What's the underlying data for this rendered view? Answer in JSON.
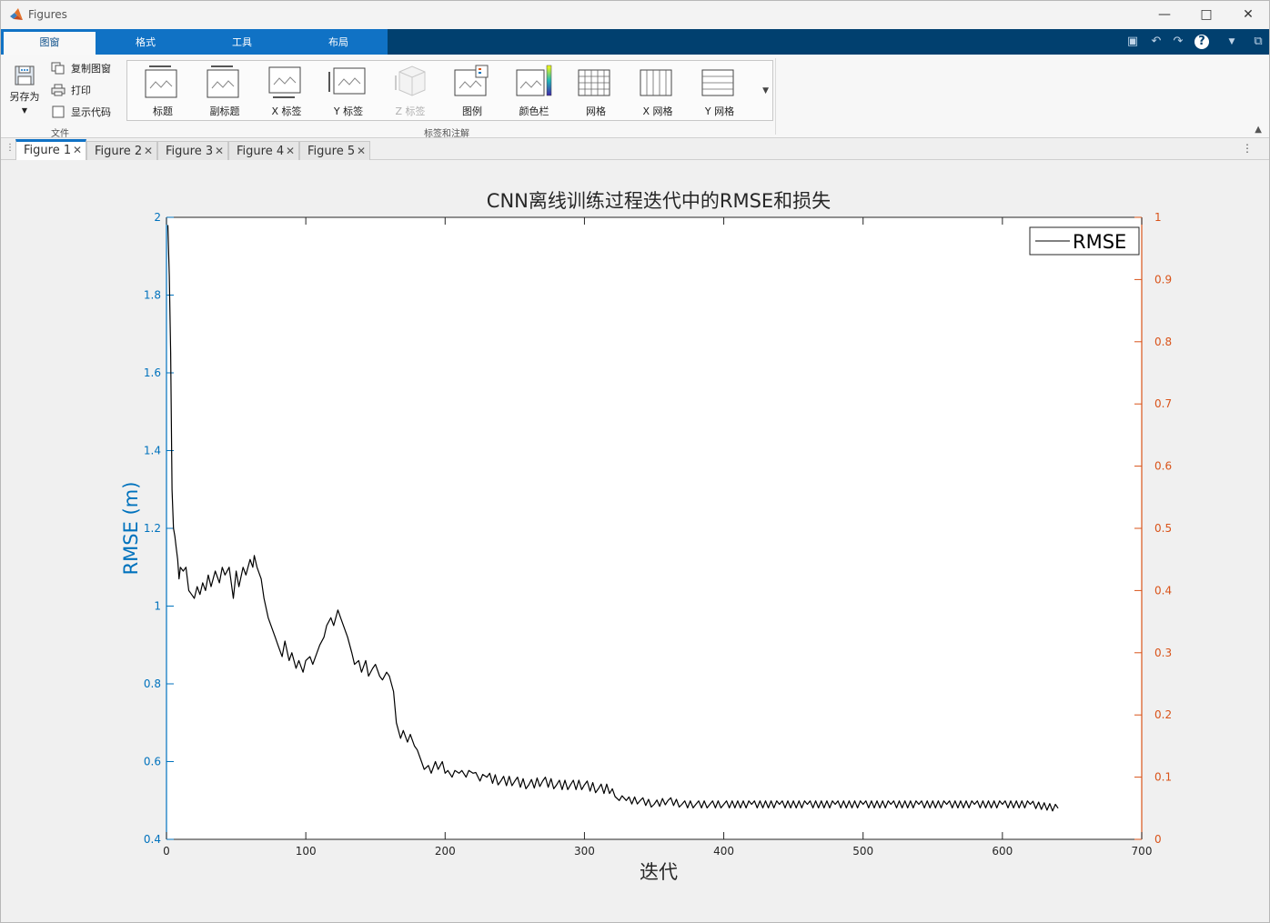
{
  "window": {
    "title": "Figures"
  },
  "ribbon_tabs": [
    "图窗",
    "格式",
    "工具",
    "布局"
  ],
  "file_group": {
    "save_as": "另存为",
    "copy_figure": "复制图窗",
    "print": "打印",
    "show_code": "显示代码",
    "label": "文件"
  },
  "annotation_group": {
    "items": [
      "标题",
      "副标题",
      "X 标签",
      "Y 标签",
      "Z 标签",
      "图例",
      "颜色栏",
      "网格",
      "X 网格",
      "Y 网格"
    ],
    "label": "标签和注解"
  },
  "doc_tabs": [
    "Figure 1",
    "Figure 2",
    "Figure 3",
    "Figure 4",
    "Figure 5"
  ],
  "colors": {
    "left_axis": "#0072bd",
    "right_axis": "#d95319",
    "series": "#000000"
  },
  "chart_data": {
    "type": "line",
    "title": "CNN离线训练过程迭代中的RMSE和损失",
    "xlabel": "迭代",
    "ylabel": "RMSE (m)",
    "xlim": [
      0,
      700
    ],
    "ylim": [
      0.4,
      2
    ],
    "y2lim": [
      0,
      1
    ],
    "xticks": [
      "0",
      "100",
      "200",
      "300",
      "400",
      "500",
      "600",
      "700"
    ],
    "yticks": [
      "0.4",
      "0.6",
      "0.8",
      "1",
      "1.2",
      "1.4",
      "1.6",
      "1.8",
      "2"
    ],
    "y2ticks": [
      "0",
      "0.1",
      "0.2",
      "0.3",
      "0.4",
      "0.5",
      "0.6",
      "0.7",
      "0.8",
      "0.9",
      "1"
    ],
    "legend": {
      "entries": [
        "RMSE"
      ],
      "position": "top-right"
    },
    "grid": false,
    "series": [
      {
        "name": "RMSE",
        "x": [
          1,
          2,
          3,
          4,
          5,
          6,
          7,
          8,
          9,
          10,
          12,
          14,
          16,
          18,
          20,
          22,
          24,
          26,
          28,
          30,
          32,
          35,
          38,
          40,
          42,
          45,
          48,
          50,
          52,
          55,
          57,
          60,
          62,
          63,
          65,
          68,
          70,
          73,
          75,
          78,
          80,
          83,
          85,
          88,
          90,
          93,
          95,
          98,
          100,
          103,
          105,
          108,
          110,
          113,
          115,
          118,
          120,
          123,
          125,
          127,
          130,
          133,
          135,
          138,
          140,
          143,
          145,
          148,
          150,
          153,
          155,
          158,
          160,
          163,
          165,
          168,
          170,
          173,
          175,
          178,
          180,
          183,
          185,
          188,
          190,
          193,
          195,
          198,
          200,
          205,
          210,
          215,
          220,
          225,
          230,
          240,
          250,
          260,
          270,
          280,
          290,
          300,
          310,
          320,
          322,
          325,
          330,
          340,
          350,
          360,
          370,
          380,
          390,
          400,
          420,
          440,
          460,
          480,
          500,
          520,
          540,
          560,
          580,
          600,
          620,
          640
        ],
        "y": [
          1.98,
          1.85,
          1.65,
          1.3,
          1.2,
          1.18,
          1.15,
          1.12,
          1.07,
          1.1,
          1.09,
          1.1,
          1.04,
          1.03,
          1.02,
          1.05,
          1.03,
          1.06,
          1.04,
          1.08,
          1.05,
          1.09,
          1.06,
          1.1,
          1.08,
          1.1,
          1.02,
          1.09,
          1.05,
          1.1,
          1.08,
          1.12,
          1.1,
          1.13,
          1.1,
          1.07,
          1.02,
          0.97,
          0.95,
          0.92,
          0.9,
          0.87,
          0.91,
          0.86,
          0.88,
          0.84,
          0.86,
          0.83,
          0.86,
          0.87,
          0.85,
          0.88,
          0.9,
          0.92,
          0.95,
          0.97,
          0.95,
          0.99,
          0.97,
          0.95,
          0.92,
          0.88,
          0.85,
          0.86,
          0.83,
          0.86,
          0.82,
          0.84,
          0.85,
          0.82,
          0.81,
          0.83,
          0.82,
          0.78,
          0.7,
          0.66,
          0.68,
          0.65,
          0.67,
          0.64,
          0.63,
          0.6,
          0.58,
          0.59,
          0.57,
          0.6,
          0.58,
          0.6,
          0.57,
          0.56,
          0.57,
          0.56,
          0.57,
          0.55,
          0.56,
          0.55,
          0.55,
          0.54,
          0.55,
          0.54,
          0.54,
          0.54,
          0.53,
          0.53,
          0.51,
          0.5,
          0.5,
          0.5,
          0.49,
          0.5,
          0.49,
          0.49,
          0.49,
          0.49,
          0.49,
          0.49,
          0.49,
          0.49,
          0.49,
          0.49,
          0.49,
          0.49,
          0.49,
          0.49,
          0.49,
          0.48
        ]
      }
    ]
  }
}
